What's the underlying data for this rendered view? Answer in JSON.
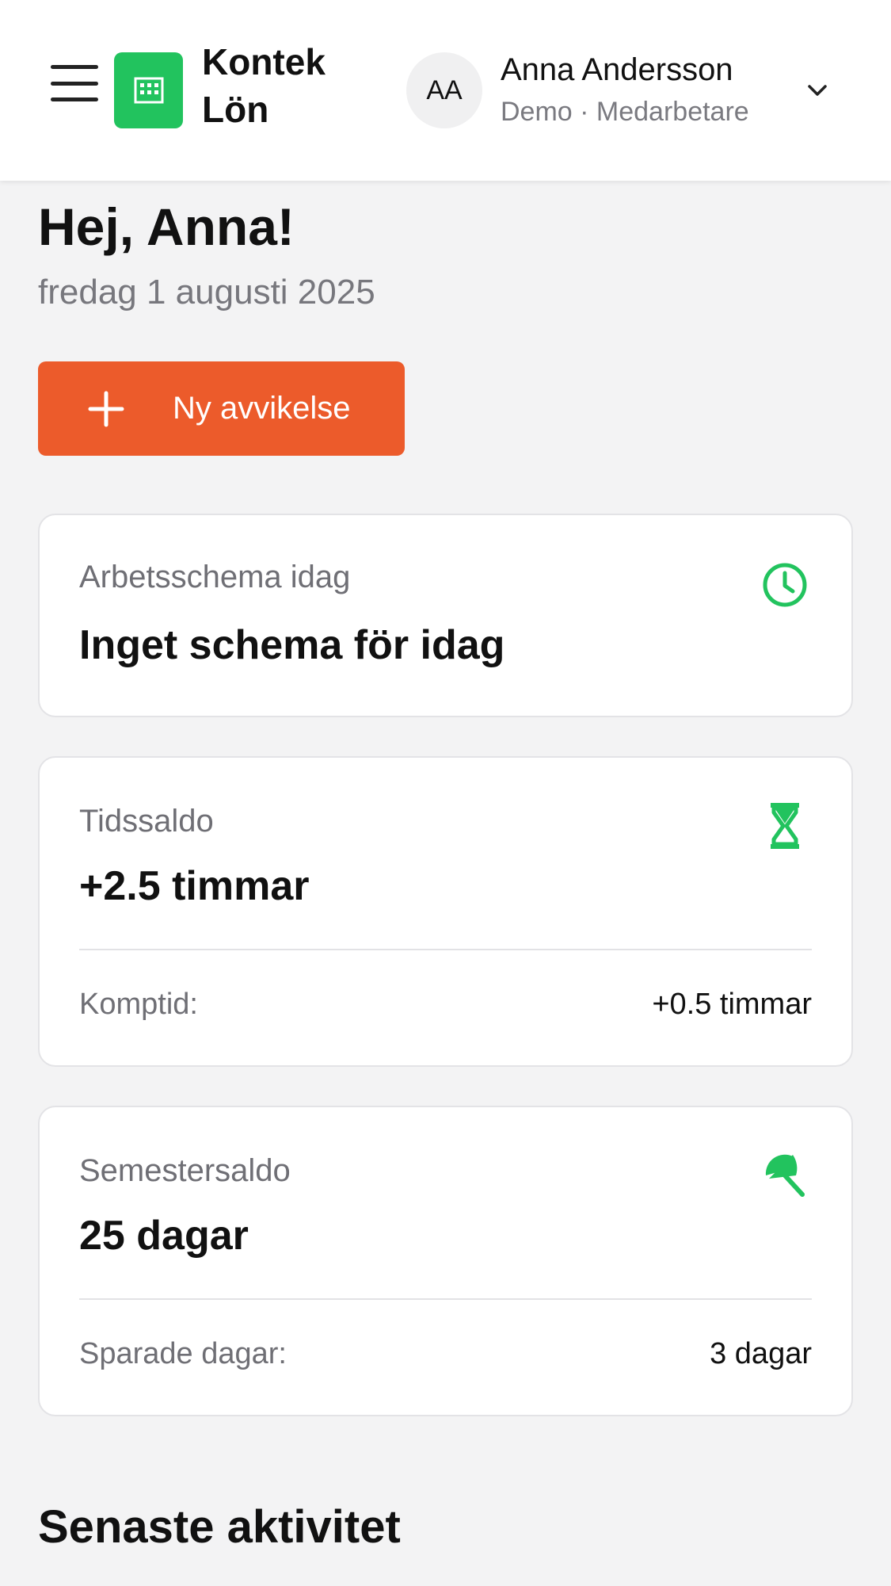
{
  "header": {
    "menu_icon": "hamburger-menu-icon",
    "logo_icon": "building-icon",
    "brand_line1": "Kontek",
    "brand_line2": "Lön",
    "avatar_initials": "AA",
    "user_name": "Anna Andersson",
    "user_role": "Demo · Medarbetare",
    "chevron_icon": "chevron-down-icon"
  },
  "greeting": {
    "title": "Hej, Anna!",
    "date": "fredag 1 augusti 2025"
  },
  "actions": {
    "new_deviation_label": "Ny avvikelse",
    "new_deviation_icon": "plus-icon"
  },
  "cards": {
    "schedule": {
      "label": "Arbetsschema idag",
      "value": "Inget schema för idag",
      "icon": "clock-icon"
    },
    "time_balance": {
      "label": "Tidssaldo",
      "value": "+2.5 timmar",
      "icon": "hourglass-icon",
      "sub_label": "Komptid:",
      "sub_value": "+0.5 timmar"
    },
    "vacation_balance": {
      "label": "Semestersaldo",
      "value": "25 dagar",
      "icon": "beach-umbrella-icon",
      "sub_label": "Sparade dagar:",
      "sub_value": "3 dagar"
    }
  },
  "recent": {
    "title": "Senaste aktivitet"
  },
  "colors": {
    "accent_green": "#22c35e",
    "primary_orange": "#ec5b2b",
    "background": "#f3f3f4"
  }
}
